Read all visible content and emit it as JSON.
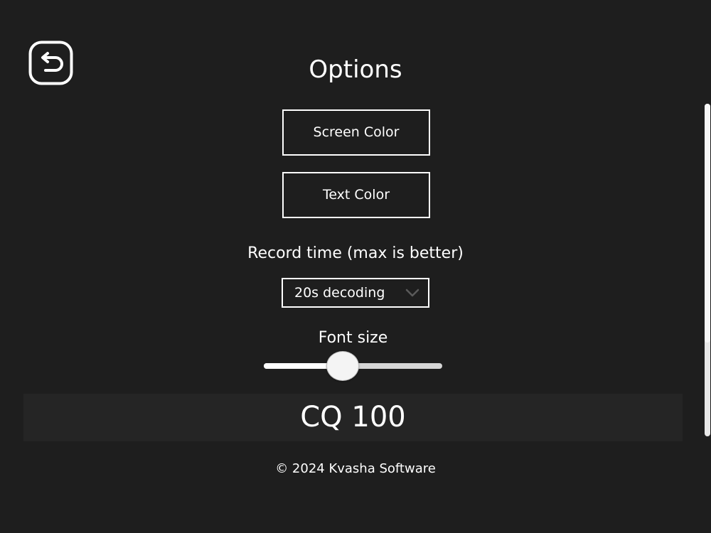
{
  "header": {
    "title": "Options",
    "back_icon": "back-arrow-icon"
  },
  "buttons": {
    "screen_color": "Screen Color",
    "text_color": "Text Color"
  },
  "record_time": {
    "label": "Record time (max is better)",
    "selected": "20s decoding"
  },
  "font_size": {
    "label": "Font size",
    "value_fraction": 0.43
  },
  "preview": {
    "text": "CQ 100"
  },
  "footer": {
    "copyright": "© 2024 Kvasha Software"
  },
  "colors": {
    "background": "#1e1e1e",
    "foreground": "#ffffff",
    "preview_background": "#252525"
  }
}
